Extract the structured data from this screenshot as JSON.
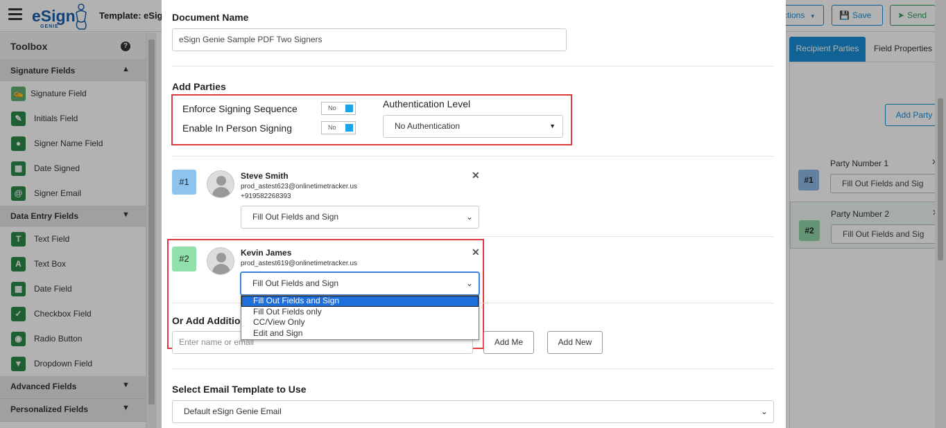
{
  "header": {
    "logo_text": "eSign",
    "logo_subtext": "GENIE",
    "template_title": "Template: eSign",
    "actions_label": "ctions",
    "save_label": "Save",
    "send_label": "Send"
  },
  "toolbox": {
    "title": "Toolbox",
    "help_icon": "?",
    "sections": [
      {
        "title": "Signature Fields",
        "expanded": true,
        "items": [
          {
            "label": "Signature Field",
            "icon": "signature-icon"
          },
          {
            "label": "Initials Field",
            "icon": "pencil-icon"
          },
          {
            "label": "Signer Name Field",
            "icon": "person-icon"
          },
          {
            "label": "Date Signed",
            "icon": "calendar-icon"
          },
          {
            "label": "Signer Email",
            "icon": "at-icon"
          }
        ]
      },
      {
        "title": "Data Entry Fields",
        "expanded": true,
        "items": [
          {
            "label": "Text Field",
            "icon": "text-cursor-icon"
          },
          {
            "label": "Text Box",
            "icon": "letter-a-icon"
          },
          {
            "label": "Date Field",
            "icon": "calendar-icon"
          },
          {
            "label": "Checkbox Field",
            "icon": "checkbox-icon"
          },
          {
            "label": "Radio Button",
            "icon": "radio-icon"
          },
          {
            "label": "Dropdown Field",
            "icon": "dropdown-icon"
          }
        ]
      },
      {
        "title": "Advanced Fields",
        "expanded": false
      },
      {
        "title": "Personalized Fields",
        "expanded": false
      }
    ]
  },
  "right_panel": {
    "tabs": [
      "Recipient Parties",
      "Field Properties"
    ],
    "active_tab": "Recipient Parties",
    "add_party_label": "Add Party",
    "parties": [
      {
        "badge": "#1",
        "name": "Party Number 1",
        "role": "Fill Out Fields and Sig"
      },
      {
        "badge": "#2",
        "name": "Party Number 2",
        "role": "Fill Out Fields and Sig"
      }
    ]
  },
  "modal": {
    "document_name_label": "Document Name",
    "document_name_value": "eSign Genie Sample PDF Two Signers",
    "add_parties_label": "Add Parties",
    "settings": {
      "enforce_label": "Enforce Signing Sequence",
      "enforce_value": "No",
      "in_person_label": "Enable In Person Signing",
      "in_person_value": "No",
      "auth_label": "Authentication Level",
      "auth_value": "No Authentication"
    },
    "signers": [
      {
        "badge": "#1",
        "name": "Steve Smith",
        "email": "prod_astest623@onlinetimetracker.us",
        "phone": "+919582268393",
        "role": "Fill Out Fields and Sign"
      },
      {
        "badge": "#2",
        "name": "Kevin James",
        "email": "prod_astest619@onlinetimetracker.us",
        "role": "Fill Out Fields and Sign"
      }
    ],
    "role_options": [
      "Fill Out Fields and Sign",
      "Fill Out Fields only",
      "CC/View Only",
      "Edit and Sign"
    ],
    "role_selected_index": 0,
    "or_add_label": "Or Add Addition",
    "add_input_placeholder": "Enter name or email",
    "add_me_label": "Add Me",
    "add_new_label": "Add New",
    "email_template_label": "Select Email Template to Use",
    "email_template_value": "Default eSign Genie Email"
  },
  "colors": {
    "accent_blue": "#1a8fd6",
    "send_green": "#2d9b56",
    "highlight_red": "#e0383e",
    "toggle_blue": "#1aa3e8",
    "badge_1": "#8dc4ef",
    "badge_2": "#8fe0aa",
    "dropdown_selected": "#1e6fdc"
  }
}
